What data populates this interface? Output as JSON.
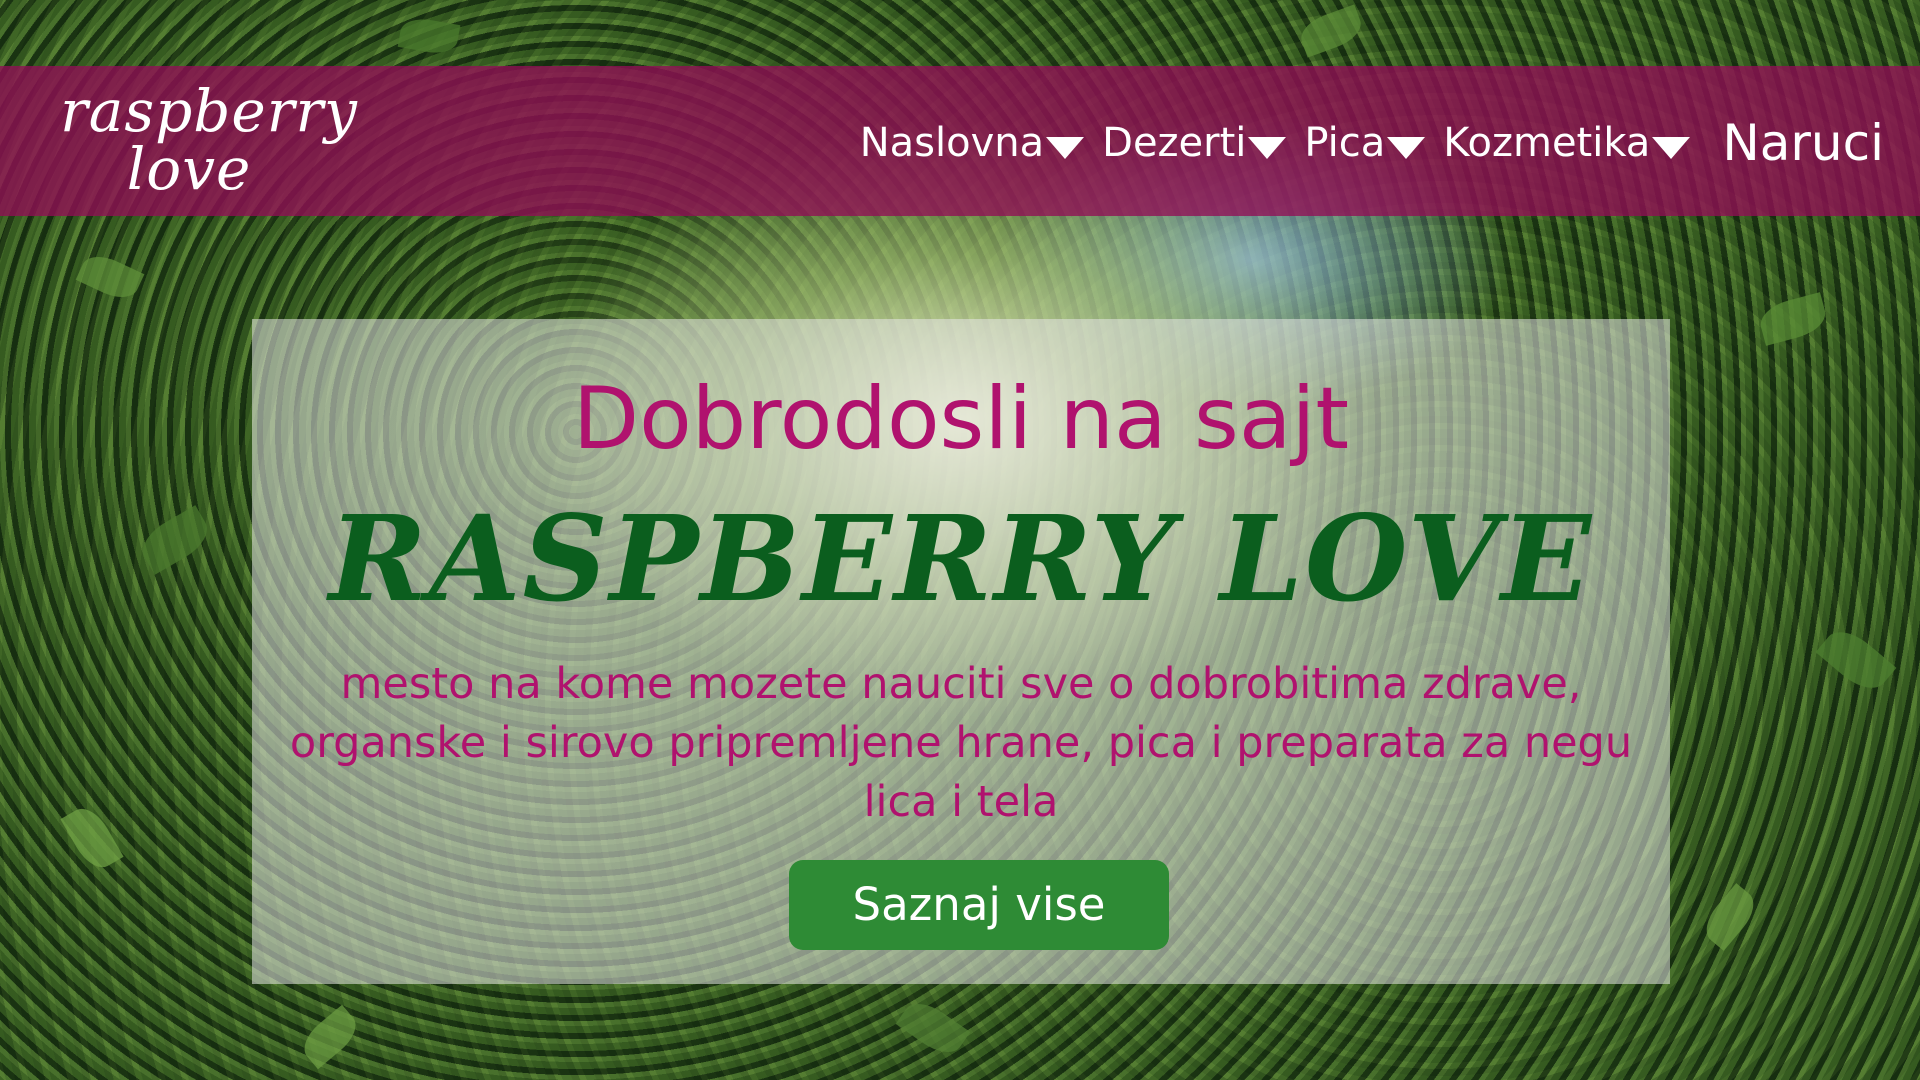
{
  "brand": {
    "logo_line1": "raspberry",
    "logo_line2": "love"
  },
  "nav": {
    "items": [
      {
        "label": "Naslovna"
      },
      {
        "label": "Dezerti"
      },
      {
        "label": "Pica"
      },
      {
        "label": "Kozmetika"
      }
    ],
    "order_label": "Naruci"
  },
  "hero": {
    "welcome": "Dobrodosli na sajt",
    "brand_title": "RASPBERRY LOVE",
    "description": "mesto na kome mozete nauciti sve o dobrobitima zdrave, organske i sirovo pripremljene hrane, pica i preparata za negu lica i tela",
    "button_label": "Saznaj vise"
  },
  "colors": {
    "header_bg": "#920e56",
    "accent_pink": "#b0126e",
    "brand_green": "#0b5e1e",
    "button_green": "#2e8b35"
  }
}
